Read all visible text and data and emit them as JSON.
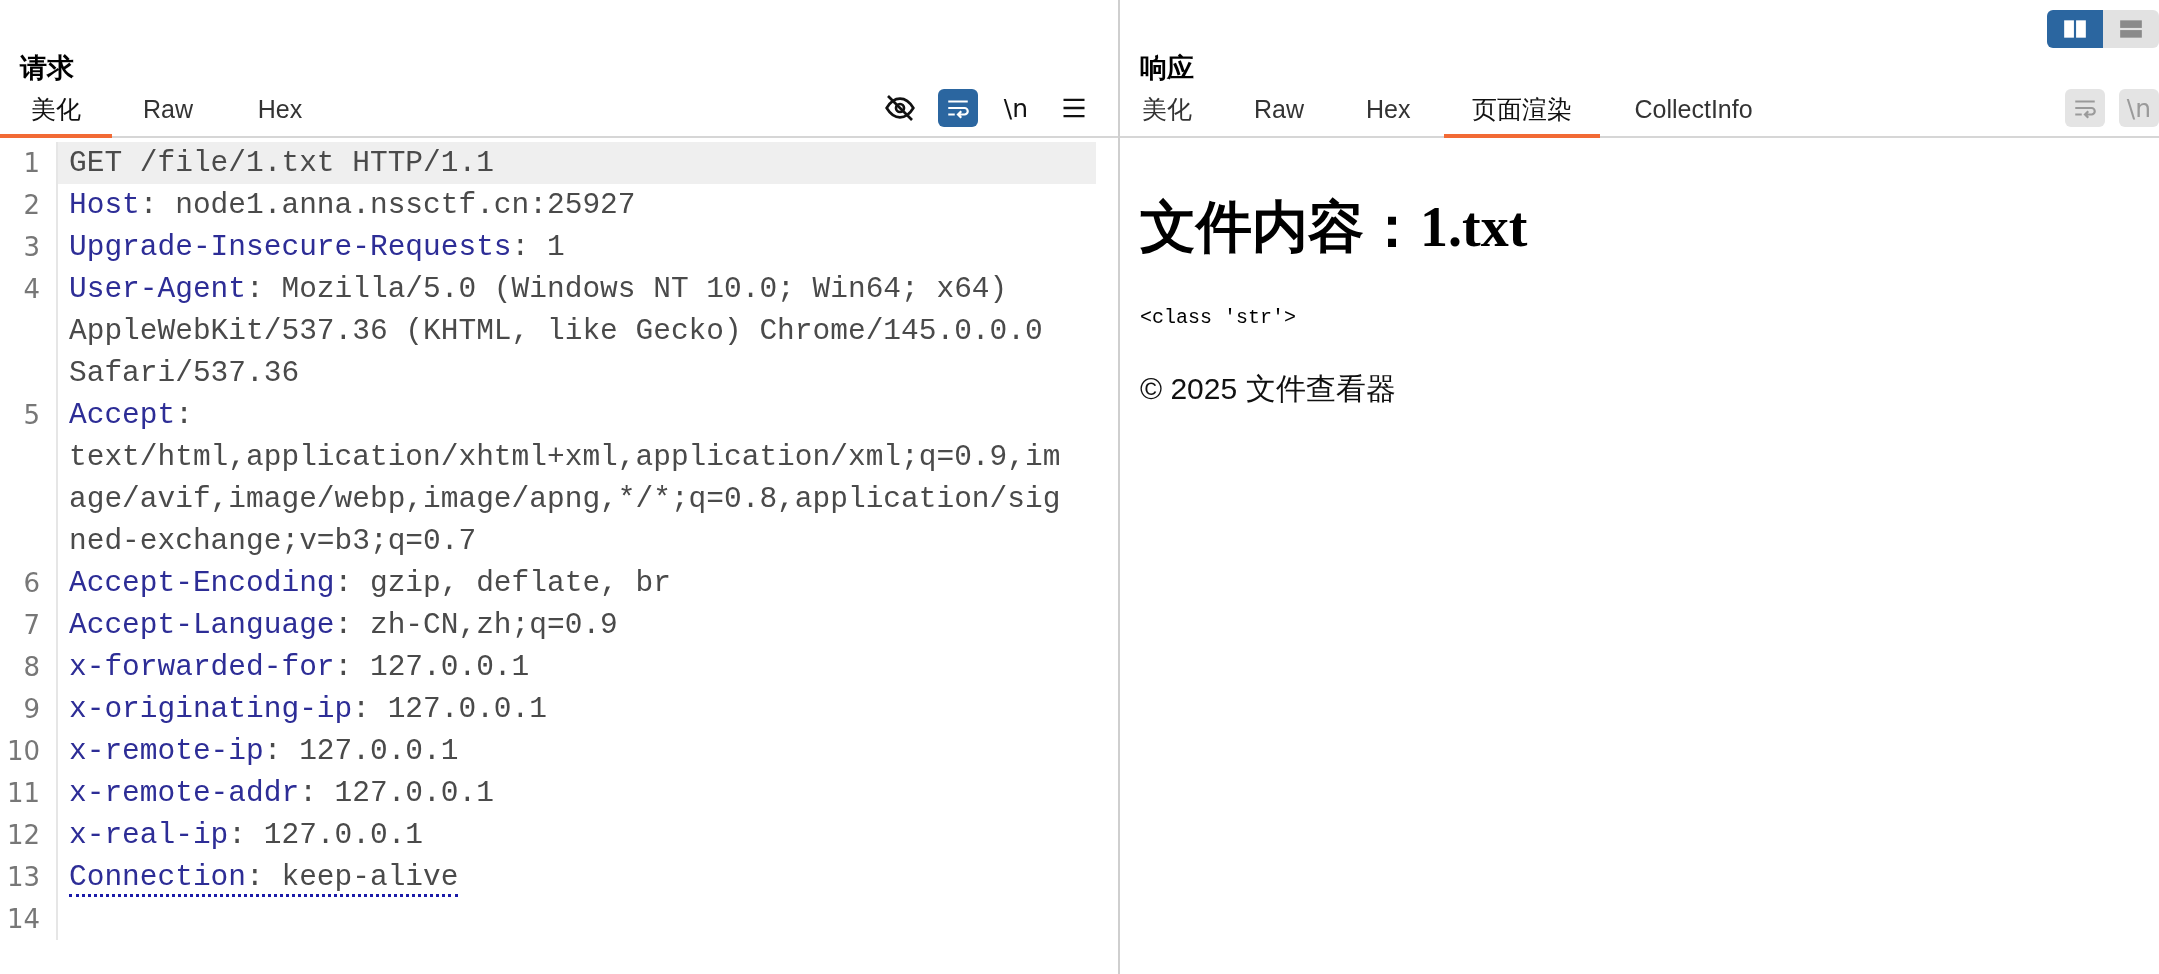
{
  "view_toggle": [
    {
      "kind": "split",
      "selected": true
    },
    {
      "kind": "stacked",
      "selected": false
    }
  ],
  "request": {
    "title": "请求",
    "tabs": [
      {
        "label": "美化",
        "selected": true
      },
      {
        "label": "Raw",
        "selected": false
      },
      {
        "label": "Hex",
        "selected": false
      }
    ],
    "toolbar": [
      {
        "kind": "hide",
        "active": false
      },
      {
        "kind": "wrap",
        "active": true
      },
      {
        "kind": "newline",
        "label": "\\n",
        "active": false
      },
      {
        "kind": "menu",
        "active": false
      }
    ],
    "lines": [
      {
        "number": "1",
        "kind": "request-line",
        "text": "GET /file/1.txt HTTP/1.1",
        "current": true
      },
      {
        "number": "2",
        "kind": "header",
        "text": "Host: node1.anna.nssctf.cn:25927",
        "current": false
      },
      {
        "number": "3",
        "kind": "header",
        "text": "Upgrade-Insecure-Requests: 1",
        "current": false
      },
      {
        "number": "4",
        "kind": "header",
        "text": "User-Agent: Mozilla/5.0 (Windows NT 10.0; Win64; x64) AppleWebKit/537.36 (KHTML, like Gecko) Chrome/145.0.0.0 Safari/537.36",
        "current": false
      },
      {
        "number": "5",
        "kind": "header",
        "text": "Accept: text/html,application/xhtml+xml,application/xml;q=0.9,image/avif,image/webp,image/apng,*/*;q=0.8,application/signed-exchange;v=b3;q=0.7",
        "current": false
      },
      {
        "number": "6",
        "kind": "header",
        "text": "Accept-Encoding: gzip, deflate, br",
        "current": false
      },
      {
        "number": "7",
        "kind": "header",
        "text": "Accept-Language: zh-CN,zh;q=0.9",
        "current": false
      },
      {
        "number": "8",
        "kind": "header",
        "text": "x-forwarded-for: 127.0.0.1",
        "current": false
      },
      {
        "number": "9",
        "kind": "header",
        "text": "x-originating-ip: 127.0.0.1",
        "current": false
      },
      {
        "number": "10",
        "kind": "header",
        "text": "x-remote-ip: 127.0.0.1",
        "current": false
      },
      {
        "number": "11",
        "kind": "header",
        "text": "x-remote-addr: 127.0.0.1",
        "current": false
      },
      {
        "number": "12",
        "kind": "header",
        "text": "x-real-ip: 127.0.0.1",
        "current": false
      },
      {
        "number": "13",
        "kind": "header",
        "text": "Connection: keep-alive",
        "current": false,
        "underlined": true
      },
      {
        "number": "14",
        "kind": "empty",
        "current": false
      }
    ]
  },
  "response": {
    "title": "响应",
    "tabs": [
      {
        "label": "美化",
        "selected": false
      },
      {
        "label": "Raw",
        "selected": false
      },
      {
        "label": "Hex",
        "selected": false
      },
      {
        "label": "页面渲染",
        "selected": true
      },
      {
        "label": "CollectInfo",
        "selected": false
      }
    ],
    "toolbar": [
      {
        "kind": "wrap",
        "disabled": true
      },
      {
        "kind": "newline",
        "label": "\\n",
        "disabled": true
      }
    ],
    "page": {
      "heading": "文件内容：1.txt",
      "type_line": "<class 'str'>",
      "footer": "© 2025 文件查看器"
    }
  }
}
